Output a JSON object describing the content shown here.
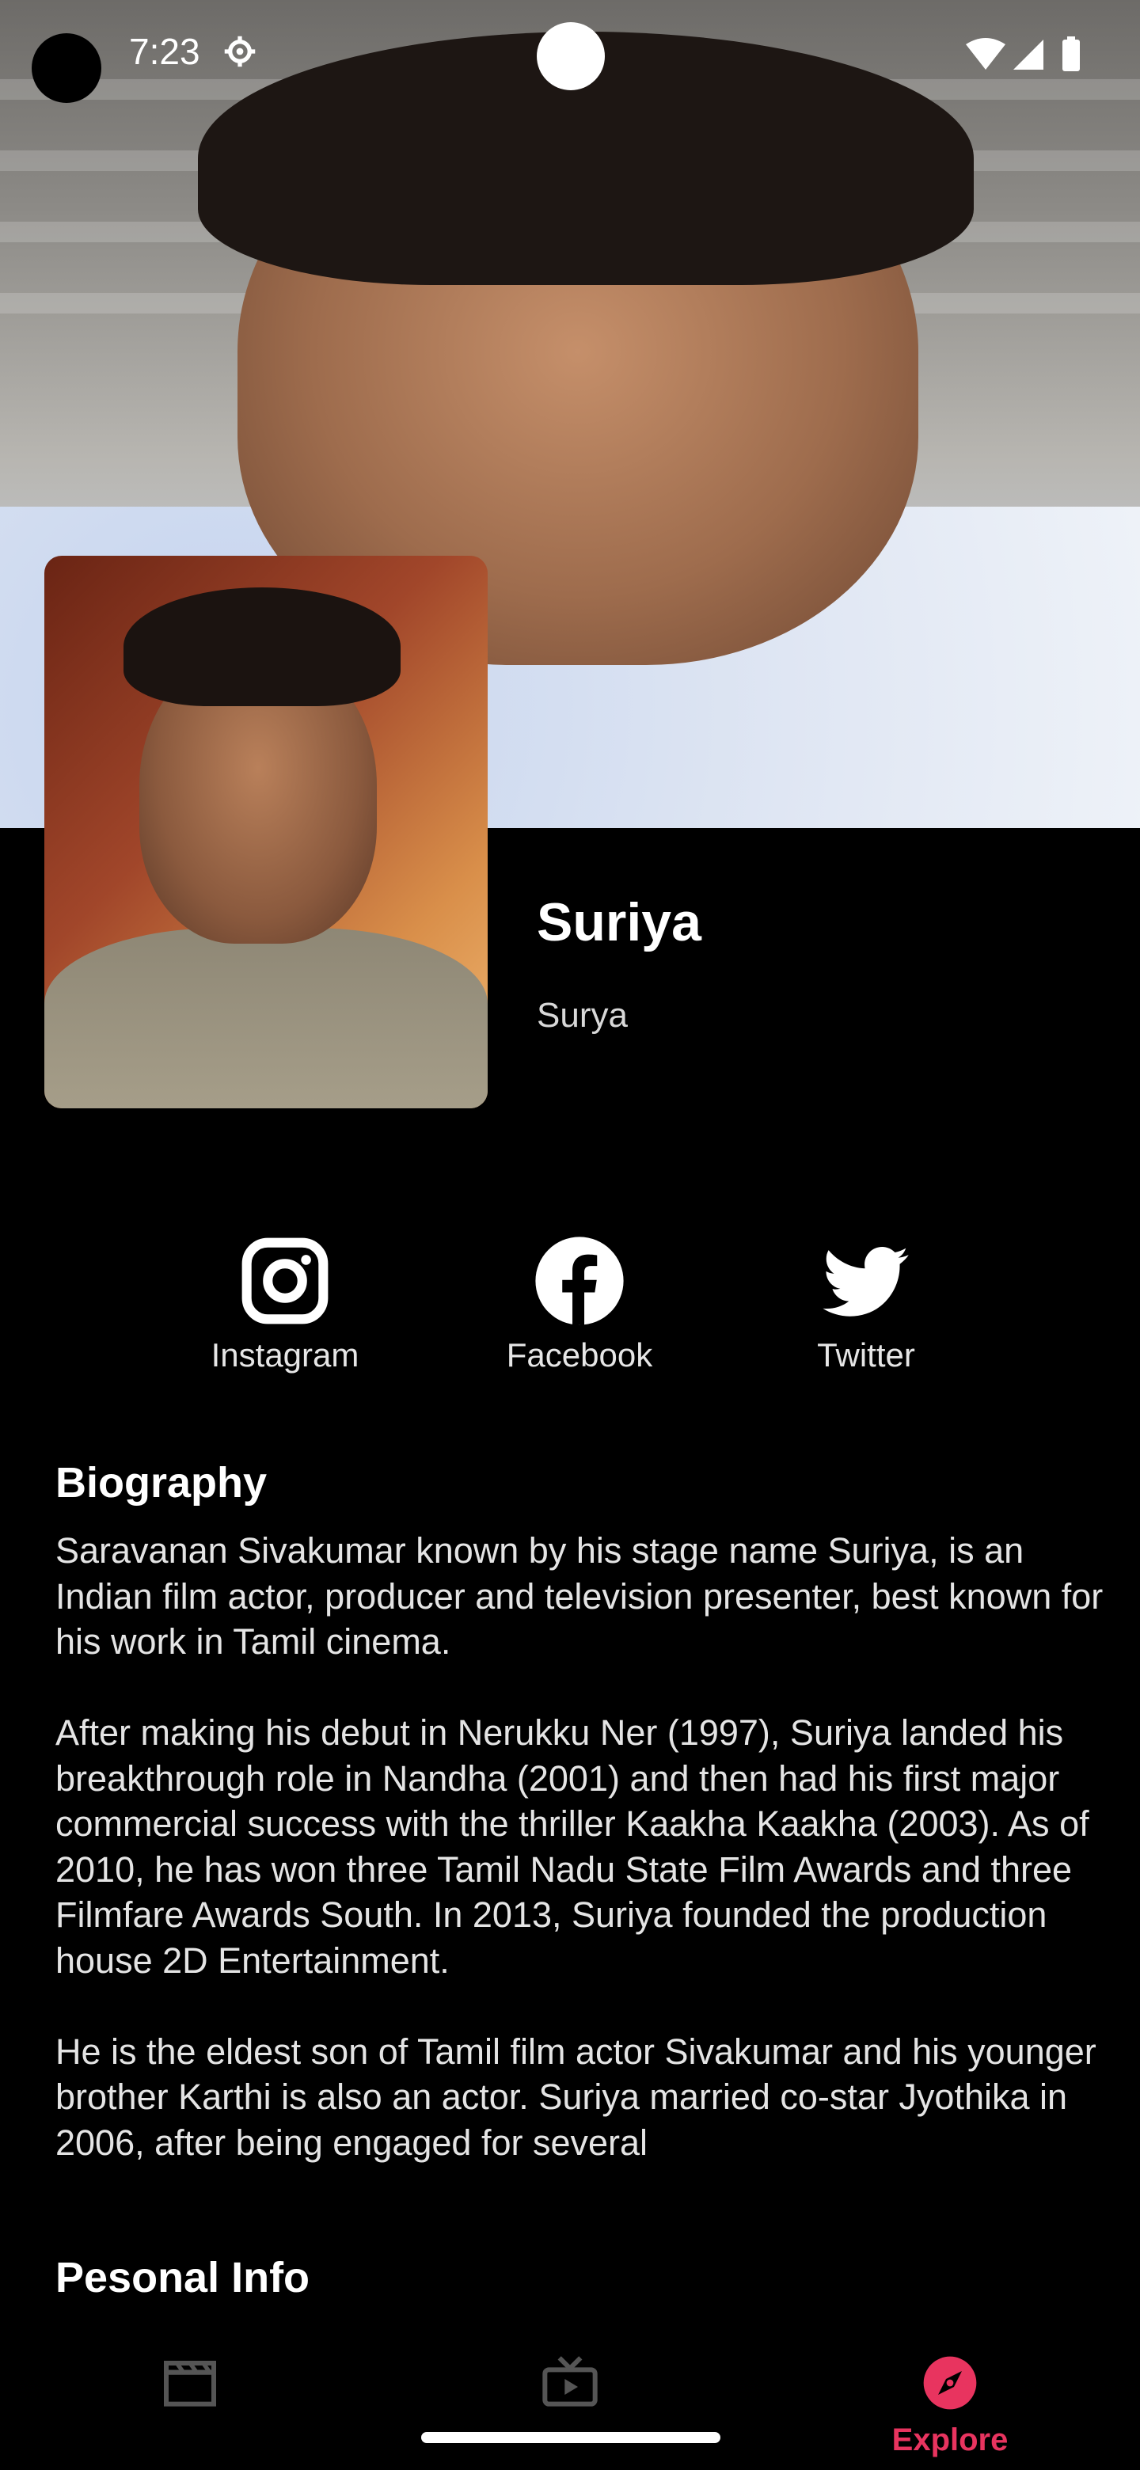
{
  "status_bar": {
    "time": "7:23"
  },
  "person": {
    "name": "Suriya",
    "also_known_as": "Surya"
  },
  "social_links": [
    {
      "label": "Instagram",
      "icon": "instagram-icon"
    },
    {
      "label": "Facebook",
      "icon": "facebook-icon"
    },
    {
      "label": "Twitter",
      "icon": "twitter-icon"
    }
  ],
  "biography": {
    "heading": "Biography",
    "text": "Saravanan Sivakumar known by his stage name Suriya, is an Indian film actor, producer and television presenter, best known for his work in Tamil cinema.\n\nAfter making his debut in Nerukku Ner (1997), Suriya landed his breakthrough role in Nandha (2001) and then had his first major commercial success with the thriller Kaakha Kaakha (2003). As of 2010, he has won three Tamil Nadu State Film Awards and three Filmfare Awards South. In 2013, Suriya founded the production house 2D Entertainment.\n\nHe is the eldest son of Tamil film actor Sivakumar and his younger brother Karthi is also an actor. Suriya married co-star Jyothika in 2006, after being engaged for several"
  },
  "personal_info": {
    "heading": "Pesonal Info"
  },
  "bottom_nav": {
    "items": [
      {
        "icon": "clapperboard-icon",
        "label": ""
      },
      {
        "icon": "tv-icon",
        "label": ""
      },
      {
        "icon": "compass-icon",
        "label": "Explore",
        "active": true
      }
    ]
  },
  "colors": {
    "accent": "#e8345f",
    "background": "#000000"
  }
}
